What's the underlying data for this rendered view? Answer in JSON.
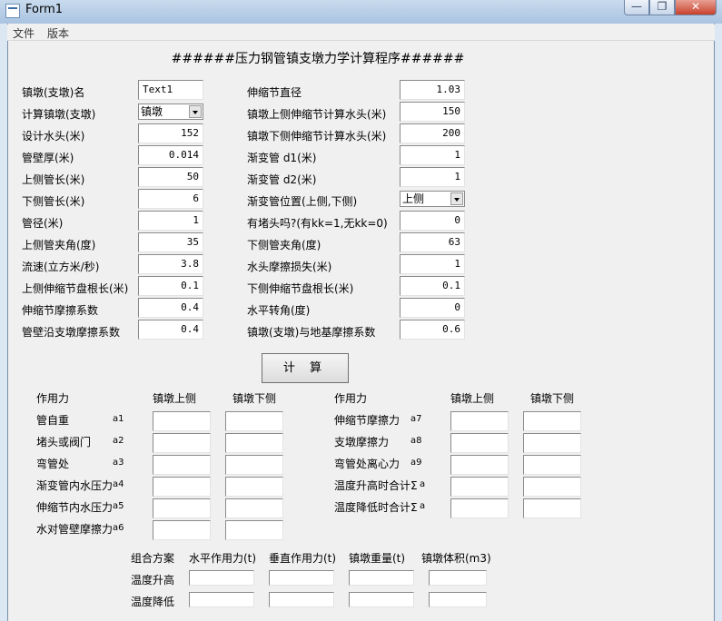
{
  "window": {
    "title": "Form1",
    "min": "—",
    "max": "❐",
    "close": "✕"
  },
  "menu": [
    "文件",
    "版本"
  ],
  "program_title": "######压力钢管镇支墩力学计算程序######",
  "left_fields": [
    {
      "label": "镇墩(支墩)名",
      "value": "Text1"
    },
    {
      "label": "计算镇墩(支墩)",
      "value": "镇墩"
    },
    {
      "label": "设计水头(米)",
      "value": "152"
    },
    {
      "label": "管壁厚(米)",
      "value": "0.014"
    },
    {
      "label": "上侧管长(米)",
      "value": "50"
    },
    {
      "label": "下侧管长(米)",
      "value": "6"
    },
    {
      "label": "管径(米)",
      "value": "1"
    },
    {
      "label": "上侧管夹角(度)",
      "value": "35"
    },
    {
      "label": "流速(立方米/秒)",
      "value": "3.8"
    },
    {
      "label": "上侧伸缩节盘根长(米)",
      "value": "0.1"
    },
    {
      "label": "伸缩节摩擦系数",
      "value": "0.4"
    },
    {
      "label": "管壁沿支墩摩擦系数",
      "value": "0.4"
    }
  ],
  "right_fields": [
    {
      "label": "伸缩节直径",
      "value": "1.03"
    },
    {
      "label": "镇墩上侧伸缩节计算水头(米)",
      "value": "150"
    },
    {
      "label": "镇墩下侧伸缩节计算水头(米)",
      "value": "200"
    },
    {
      "label": "渐变管 d1(米)",
      "value": "1"
    },
    {
      "label": "渐变管 d2(米)",
      "value": "1"
    },
    {
      "label": "渐变管位置(上侧,下侧)",
      "value": "上侧"
    },
    {
      "label": "有堵头吗?(有kk=1,无kk=0)",
      "value": "0"
    },
    {
      "label": "下侧管夹角(度)",
      "value": "63"
    },
    {
      "label": "水头摩擦损失(米)",
      "value": "1"
    },
    {
      "label": "下侧伸缩节盘根长(米)",
      "value": "0.1"
    },
    {
      "label": "水平转角(度)",
      "value": "0"
    },
    {
      "label": "镇墩(支墩)与地基摩擦系数",
      "value": "0.6"
    }
  ],
  "calc_button": "计 算",
  "forces_left": {
    "headers": [
      "作用力",
      "镇墩上侧",
      "镇墩下侧"
    ],
    "rows": [
      {
        "name": "管自重",
        "code": "a1"
      },
      {
        "name": "堵头或阀门",
        "code": "a2"
      },
      {
        "name": "弯管处",
        "code": "a3"
      },
      {
        "name": "渐变管内水压力",
        "code": "a4"
      },
      {
        "name": "伸缩节内水压力",
        "code": "a5"
      },
      {
        "name": "水对管壁摩擦力",
        "code": "a6"
      }
    ]
  },
  "forces_right": {
    "headers": [
      "作用力",
      "镇墩上侧",
      "镇墩下侧"
    ],
    "rows": [
      {
        "name": "伸缩节摩擦力",
        "code": "a7"
      },
      {
        "name": "支墩摩擦力",
        "code": "a8"
      },
      {
        "name": "弯管处离心力",
        "code": "a9"
      },
      {
        "name": "温度升高时合计Σ",
        "code": "a"
      },
      {
        "name": "温度降低时合计Σ",
        "code": "a"
      }
    ]
  },
  "combo": {
    "headers": [
      "组合方案",
      "水平作用力(t)",
      "垂直作用力(t)",
      "镇墩重量(t)",
      "镇墩体积(m3)"
    ],
    "rows": [
      "温度升高",
      "温度降低"
    ]
  }
}
